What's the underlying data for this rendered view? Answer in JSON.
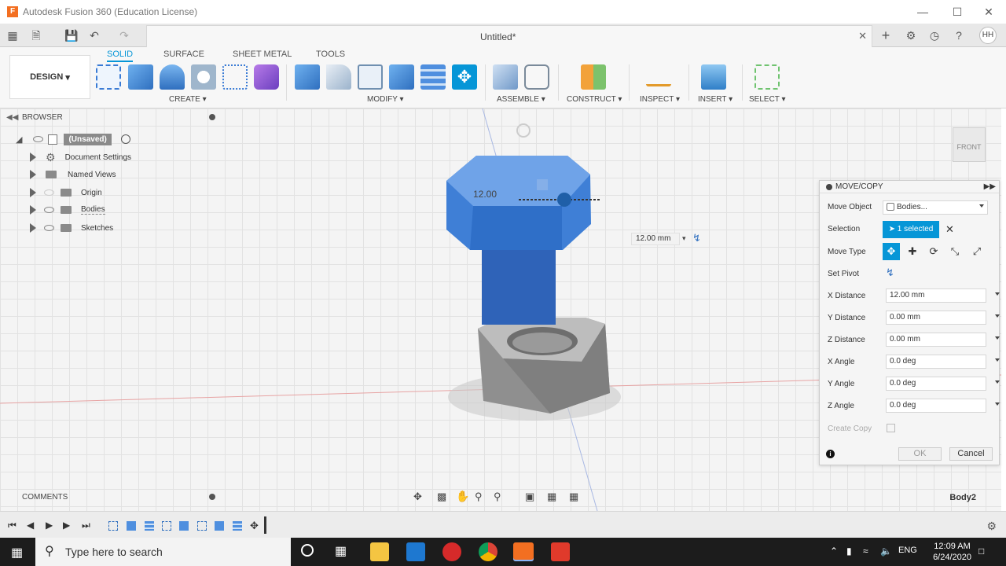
{
  "window": {
    "title": "Autodesk Fusion 360 (Education License)",
    "app_badge": "F"
  },
  "doc_tab": {
    "name": "Untitled*"
  },
  "user": {
    "initials": "HH"
  },
  "ribbon": {
    "workspace": "DESIGN",
    "tabs": [
      "SOLID",
      "SURFACE",
      "SHEET METAL",
      "TOOLS"
    ],
    "groups": [
      "CREATE",
      "MODIFY",
      "ASSEMBLE",
      "CONSTRUCT",
      "INSPECT",
      "INSERT",
      "SELECT"
    ]
  },
  "browser": {
    "title": "BROWSER",
    "root": "(Unsaved)",
    "items": [
      "Document Settings",
      "Named Views",
      "Origin",
      "Bodies",
      "Sketches"
    ]
  },
  "viewport": {
    "dim_label": "12.00",
    "distance_input": "12.00 mm",
    "viewcube": "FRONT"
  },
  "dialog": {
    "title": "MOVE/COPY",
    "move_object_label": "Move Object",
    "move_object_value": "Bodies...",
    "selection_label": "Selection",
    "selection_value": "1 selected",
    "move_type_label": "Move Type",
    "set_pivot_label": "Set Pivot",
    "fields": [
      {
        "label": "X Distance",
        "value": "12.00 mm"
      },
      {
        "label": "Y Distance",
        "value": "0.00 mm"
      },
      {
        "label": "Z Distance",
        "value": "0.00 mm"
      },
      {
        "label": "X Angle",
        "value": "0.0 deg"
      },
      {
        "label": "Y Angle",
        "value": "0.0 deg"
      },
      {
        "label": "Z Angle",
        "value": "0.0 deg"
      }
    ],
    "create_copy_label": "Create Copy",
    "ok": "OK",
    "cancel": "Cancel"
  },
  "comments": {
    "title": "COMMENTS"
  },
  "status": {
    "selected_body": "Body2"
  },
  "taskbar": {
    "search_placeholder": "Type here to search",
    "lang": "ENG",
    "time": "12:09 AM",
    "date": "6/24/2020"
  },
  "colors": {
    "accent": "#0696d7",
    "selected_body": "#3f7fd6",
    "nut": "#8f8f8f"
  }
}
